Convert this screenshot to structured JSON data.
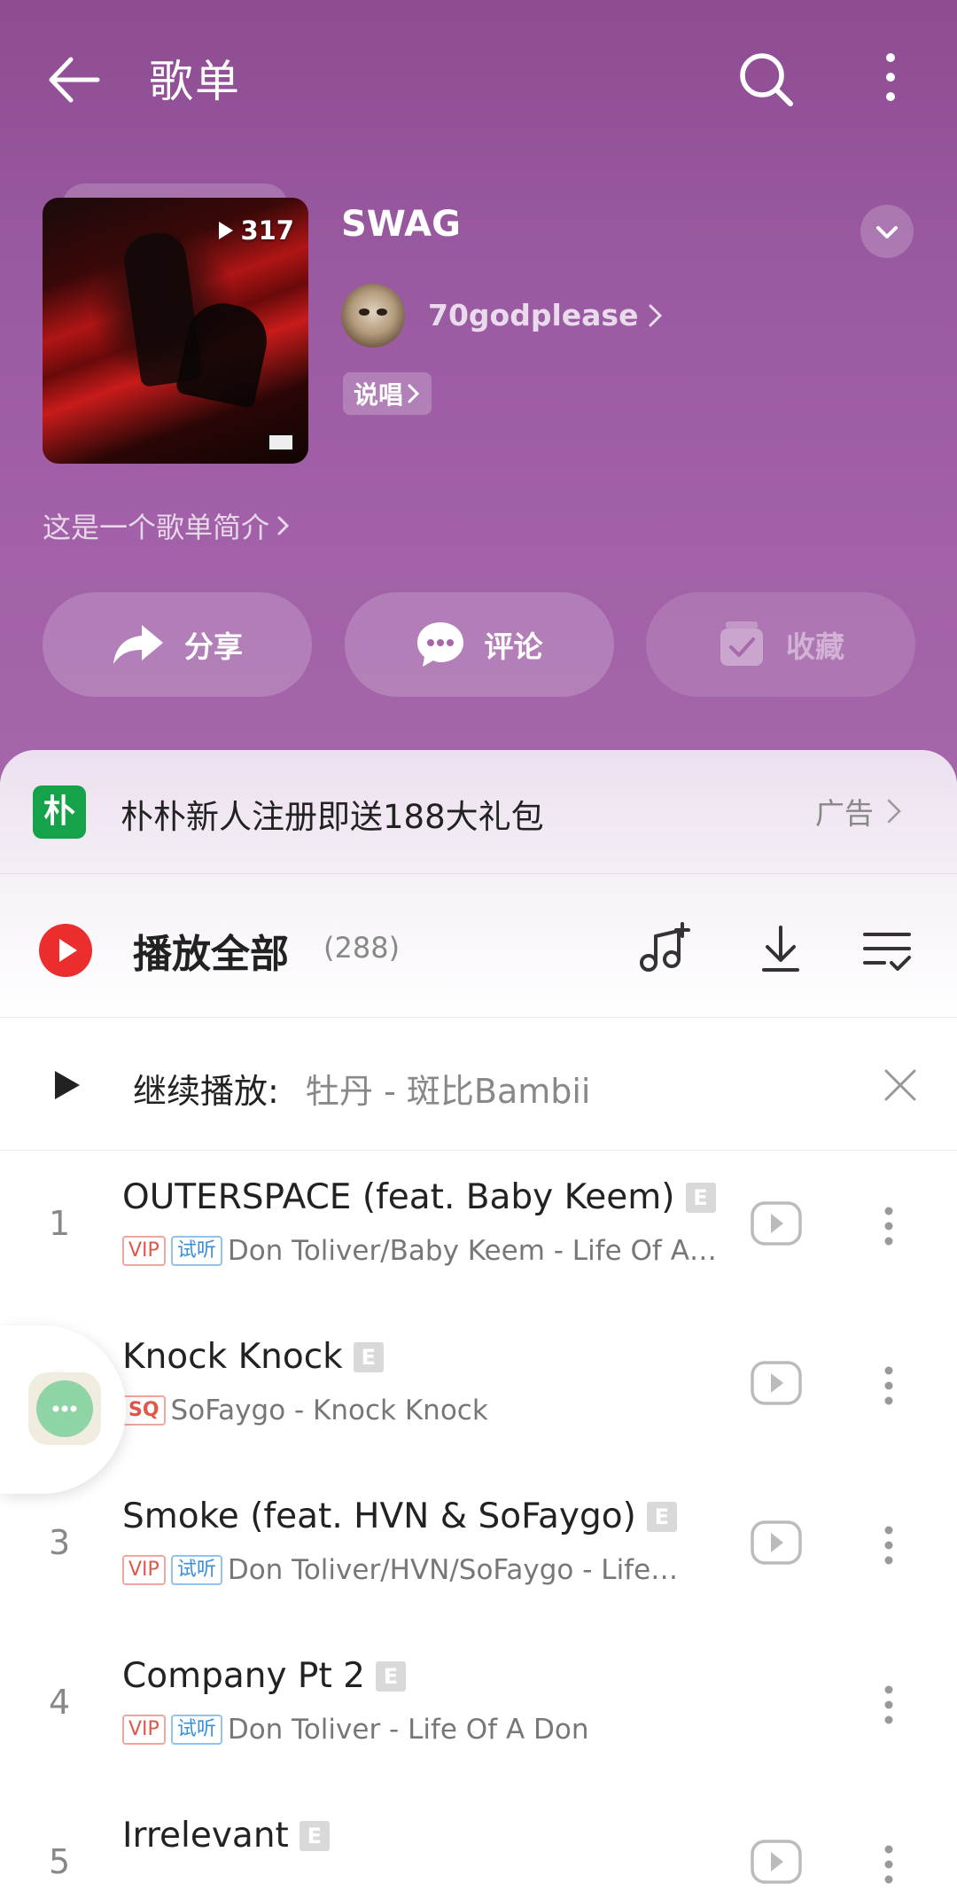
{
  "header": {
    "title": "歌单"
  },
  "playlist": {
    "name": "SWAG",
    "play_count": "317",
    "creator": "70godplease",
    "tag": "说唱",
    "intro": "这是一个歌单简介"
  },
  "actions": {
    "share": "分享",
    "comment": "评论",
    "collect": "收藏"
  },
  "ad": {
    "logo_text": "朴",
    "text": "朴朴新人注册即送188大礼包",
    "label": "广告"
  },
  "play_all": {
    "label": "播放全部",
    "count": "(288)"
  },
  "resume": {
    "label": "继续播放:",
    "track": "牡丹 - 斑比Bambii"
  },
  "songs": [
    {
      "index": "1",
      "title": "OUTERSPACE (feat. Baby Keem)",
      "explicit": "E",
      "vip": "VIP",
      "trial": "试听",
      "subtitle": "Don Toliver/Baby Keem - Life Of A…",
      "video": true
    },
    {
      "index": "2",
      "title": "Knock Knock",
      "explicit": "E",
      "quality": "SQ",
      "subtitle": "SoFaygo - Knock Knock",
      "video": true
    },
    {
      "index": "3",
      "title": "Smoke (feat. HVN & SoFaygo)",
      "explicit": "E",
      "vip": "VIP",
      "trial": "试听",
      "subtitle": "Don Toliver/HVN/SoFaygo - Life…",
      "video": true
    },
    {
      "index": "4",
      "title": "Company Pt 2",
      "explicit": "E",
      "vip": "VIP",
      "trial": "试听",
      "subtitle": "Don Toliver - Life Of A Don",
      "video": false
    },
    {
      "index": "5",
      "title": "Irrelevant",
      "explicit": "E",
      "video": true
    }
  ],
  "colors": {
    "header_bg": "#9a5aa1",
    "accent_red": "#eb2d2d",
    "ad_green": "#15a24a"
  }
}
